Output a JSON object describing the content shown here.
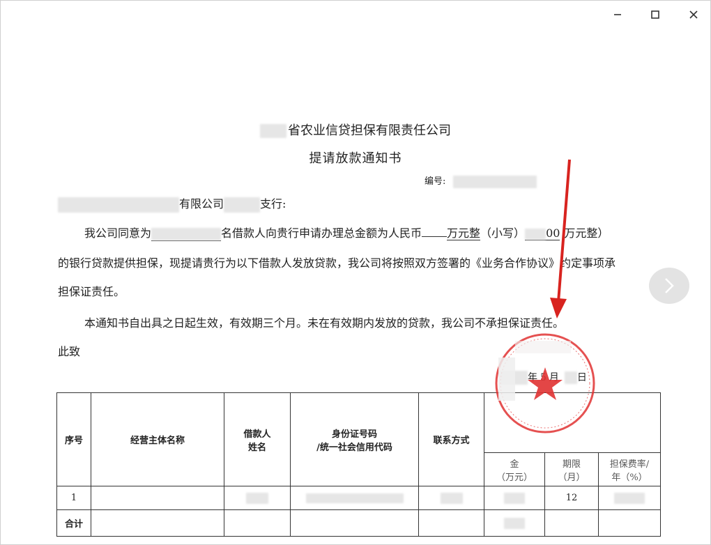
{
  "window": {
    "minimize_label": "minimize",
    "maximize_label": "maximize",
    "close_label": "close"
  },
  "document": {
    "company_title": "省农业信贷担保有限责任公司",
    "notice_title": "提请放款通知书",
    "number_label": "编号:",
    "addressee_mid": "有限公司",
    "addressee_end": "支行:",
    "para1_a": "我公司同意为",
    "para1_b": "名借款人向贵行申请办理总金额为人民币",
    "para1_c": "万元整",
    "para1_d": "（小写）",
    "para1_e": "00",
    "para1_f": "万元整）",
    "para2": "的银行贷款提供担保，现提请贵行为以下借款人发放贷款，我公司将按照双方签署的《业务合作协议》约定事项承",
    "para3": "担保证责任。",
    "para4": "本通知书自出具之日起生效，有效期三个月。未在有效期内发放的贷款，我公司不承担保证责任。",
    "closing": "此致",
    "date_year_suffix": "年",
    "date_month": "5",
    "date_month_label": "月",
    "date_day_label": "日"
  },
  "table": {
    "headers": {
      "seq": "序号",
      "entity": "经营主体名称",
      "borrower_1": "借款人",
      "borrower_2": "姓名",
      "id_1": "身份证号码",
      "id_2": "/统一社会信用代码",
      "contact": "联系方式",
      "amount_1": "金",
      "amount_2": "（万元）",
      "term_1": "期限",
      "term_2": "（月）",
      "fee_1": "担保费率/",
      "fee_2": "年（%）"
    },
    "rows": [
      {
        "seq": "1",
        "term": "12"
      }
    ],
    "total_label": "合计"
  },
  "colors": {
    "stamp": "#e03232",
    "arrow": "#d8231f",
    "border": "#333333"
  }
}
